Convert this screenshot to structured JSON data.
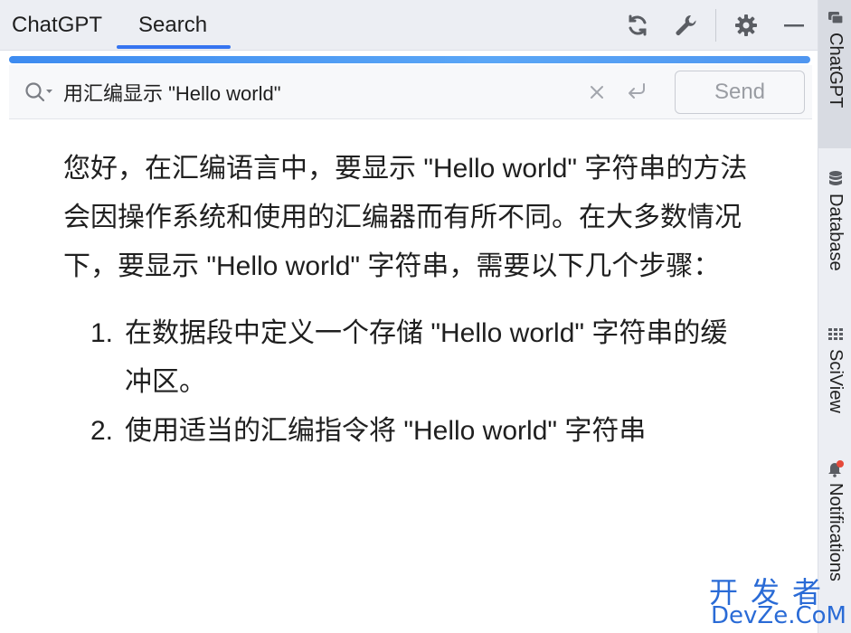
{
  "tabs": [
    {
      "label": "ChatGPT",
      "active": false
    },
    {
      "label": "Search",
      "active": true
    }
  ],
  "toolbar": {
    "icons": [
      "refresh-icon",
      "wrench-icon",
      "gear-icon",
      "minimize-icon"
    ]
  },
  "search": {
    "value": "用汇编显示 \"Hello world\"",
    "send_label": "Send"
  },
  "content": {
    "paragraph": "您好，在汇编语言中，要显示 \"Hello world\" 字符串的方法会因操作系统和使用的汇编器而有所不同。在大多数情况下，要显示 \"Hello world\" 字符串，需要以下几个步骤：",
    "steps": [
      {
        "num": "1.",
        "text": "在数据段中定义一个存储 \"Hello world\" 字符串的缓冲区。"
      },
      {
        "num": "2.",
        "text": "使用适当的汇编指令将 \"Hello world\" 字符串"
      }
    ]
  },
  "side_tabs": [
    {
      "label": "ChatGPT",
      "icon": "chat-icon",
      "active": true
    },
    {
      "label": "Database",
      "icon": "database-icon",
      "active": false
    },
    {
      "label": "SciView",
      "icon": "grid-icon",
      "active": false
    },
    {
      "label": "Notifications",
      "icon": "bell-icon",
      "active": false
    }
  ],
  "watermark": {
    "line1": "开发者",
    "line2": "DevZe.CoM"
  },
  "colors": {
    "accent": "#3574f0",
    "progress": "#4a95f2",
    "background": "#ffffff",
    "toolbar": "#eceef3"
  }
}
